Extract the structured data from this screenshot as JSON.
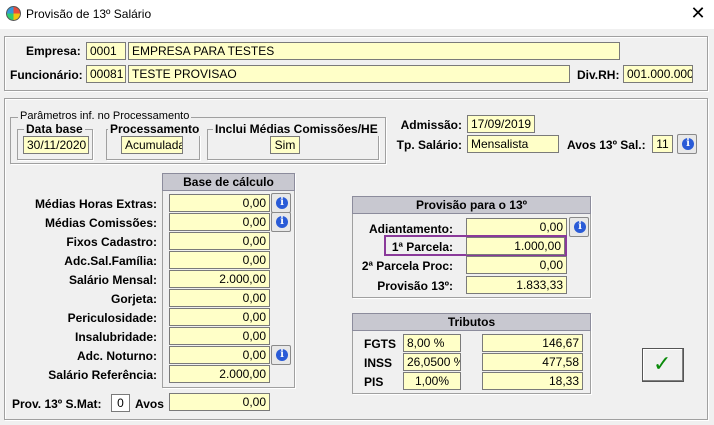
{
  "window": {
    "title": "Provisão de 13º Salário",
    "close_icon": "close-icon"
  },
  "header": {
    "empresa_label": "Empresa:",
    "empresa_code": "0001",
    "empresa_name": "EMPRESA PARA TESTES",
    "funcionario_label": "Funcionário:",
    "funcionario_code": "00081",
    "funcionario_name": "TESTE PROVISAO",
    "divrh_label": "Div.RH:",
    "divrh_value": "001.000.000"
  },
  "parametros": {
    "legend": "Parâmetros inf. no Processamento",
    "data_base_legend": "Data base",
    "data_base_value": "30/11/2020",
    "processamento_legend": "Processamento",
    "processamento_value": "Acumulada",
    "inclui_legend": "Inclui Médias Comissões/HE",
    "inclui_value": "Sim"
  },
  "admissao": {
    "label": "Admissão:",
    "value": "17/09/2019",
    "tp_salario_label": "Tp. Salário:",
    "tp_salario_value": "Mensalista",
    "avos_label": "Avos 13º Sal.:",
    "avos_value": "11"
  },
  "base_calculo": {
    "header": "Base de cálculo",
    "rows": [
      {
        "label": "Médias Horas Extras:",
        "value": "0,00"
      },
      {
        "label": "Médias Comissões:",
        "value": "0,00"
      },
      {
        "label": "Fixos Cadastro:",
        "value": "0,00"
      },
      {
        "label": "Adc.Sal.Família:",
        "value": "0,00"
      },
      {
        "label": "Salário Mensal:",
        "value": "2.000,00"
      },
      {
        "label": "Gorjeta:",
        "value": "0,00"
      },
      {
        "label": "Periculosidade:",
        "value": "0,00"
      },
      {
        "label": "Insalubridade:",
        "value": "0,00"
      },
      {
        "label": "Adc. Noturno:",
        "value": "0,00"
      },
      {
        "label": "Salário Referência:",
        "value": "2.000,00"
      }
    ],
    "prov_label": "Prov. 13º S.Mat:",
    "prov_avos_value": "0",
    "prov_avos_label": "Avos",
    "prov_value": "0,00"
  },
  "provisao": {
    "header": "Provisão para o 13º",
    "rows": [
      {
        "label": "Adiantamento:",
        "value": "0,00"
      },
      {
        "label": "1ª Parcela:",
        "value": "1.000,00"
      },
      {
        "label": "2ª Parcela Proc:",
        "value": "0,00"
      },
      {
        "label": "Provisão 13º:",
        "value": "1.833,33"
      }
    ]
  },
  "tributos": {
    "header": "Tributos",
    "rows": [
      {
        "label": "FGTS",
        "rate": "8,00 %",
        "value": "146,67"
      },
      {
        "label": "INSS",
        "rate": "26,0500 %",
        "value": "477,58"
      },
      {
        "label": "PIS",
        "rate": "1,00%",
        "value": "18,33"
      }
    ]
  },
  "ok_button": {
    "icon": "check-icon",
    "glyph": "✓"
  },
  "colors": {
    "field_bg": "#ffffc8",
    "highlight": "#8a3a9a",
    "check": "#0a8a0a"
  }
}
